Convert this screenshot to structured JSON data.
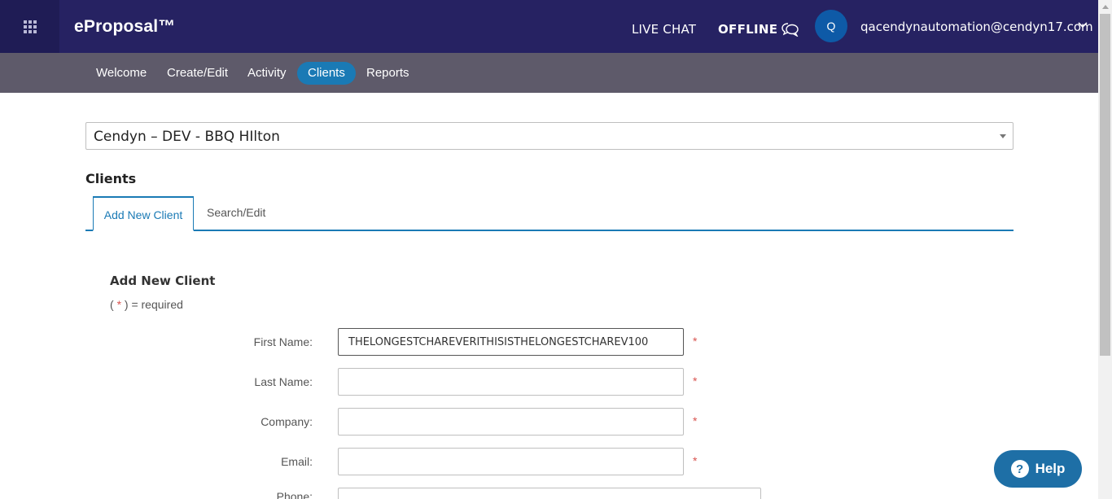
{
  "header": {
    "apps_icon": "grid-icon",
    "brand": "eProposal™",
    "live_chat": "LIVE CHAT",
    "offline": "OFFLINE",
    "chat_icon": "chat-bubbles-icon",
    "avatar_initial": "Q",
    "user_email": "qacendynautomation@cendyn17.com",
    "user_menu_icon": "chevron-down-icon"
  },
  "nav": {
    "items": [
      {
        "label": "Welcome",
        "active": false
      },
      {
        "label": "Create/Edit",
        "active": false
      },
      {
        "label": "Activity",
        "active": false
      },
      {
        "label": "Clients",
        "active": true
      },
      {
        "label": "Reports",
        "active": false
      }
    ]
  },
  "property_select": {
    "value": "Cendyn – DEV - BBQ HIlton"
  },
  "page": {
    "section_title": "Clients",
    "tabs": [
      {
        "label": "Add New Client",
        "active": true
      },
      {
        "label": "Search/Edit",
        "active": false
      }
    ]
  },
  "form": {
    "title": "Add New Client",
    "required_note_prefix": "( ",
    "required_star": "*",
    "required_note_suffix": " ) = required",
    "fields": [
      {
        "label": "First Name:",
        "value": "THELONGESTCHAREVERITHISISTHELONGESTCHAREV100",
        "required": "*"
      },
      {
        "label": "Last Name:",
        "value": "",
        "required": "*"
      },
      {
        "label": "Company:",
        "value": "",
        "required": "*"
      },
      {
        "label": "Email:",
        "value": "",
        "required": "*"
      },
      {
        "label": "Phone:",
        "value": ""
      }
    ]
  },
  "help": {
    "label": "Help",
    "icon": "question-mark-icon",
    "icon_glyph": "?"
  },
  "colors": {
    "header_bg": "#262262",
    "nav_bg": "#5e5a6a",
    "accent": "#1a7ab5",
    "required": "#d9534f"
  }
}
